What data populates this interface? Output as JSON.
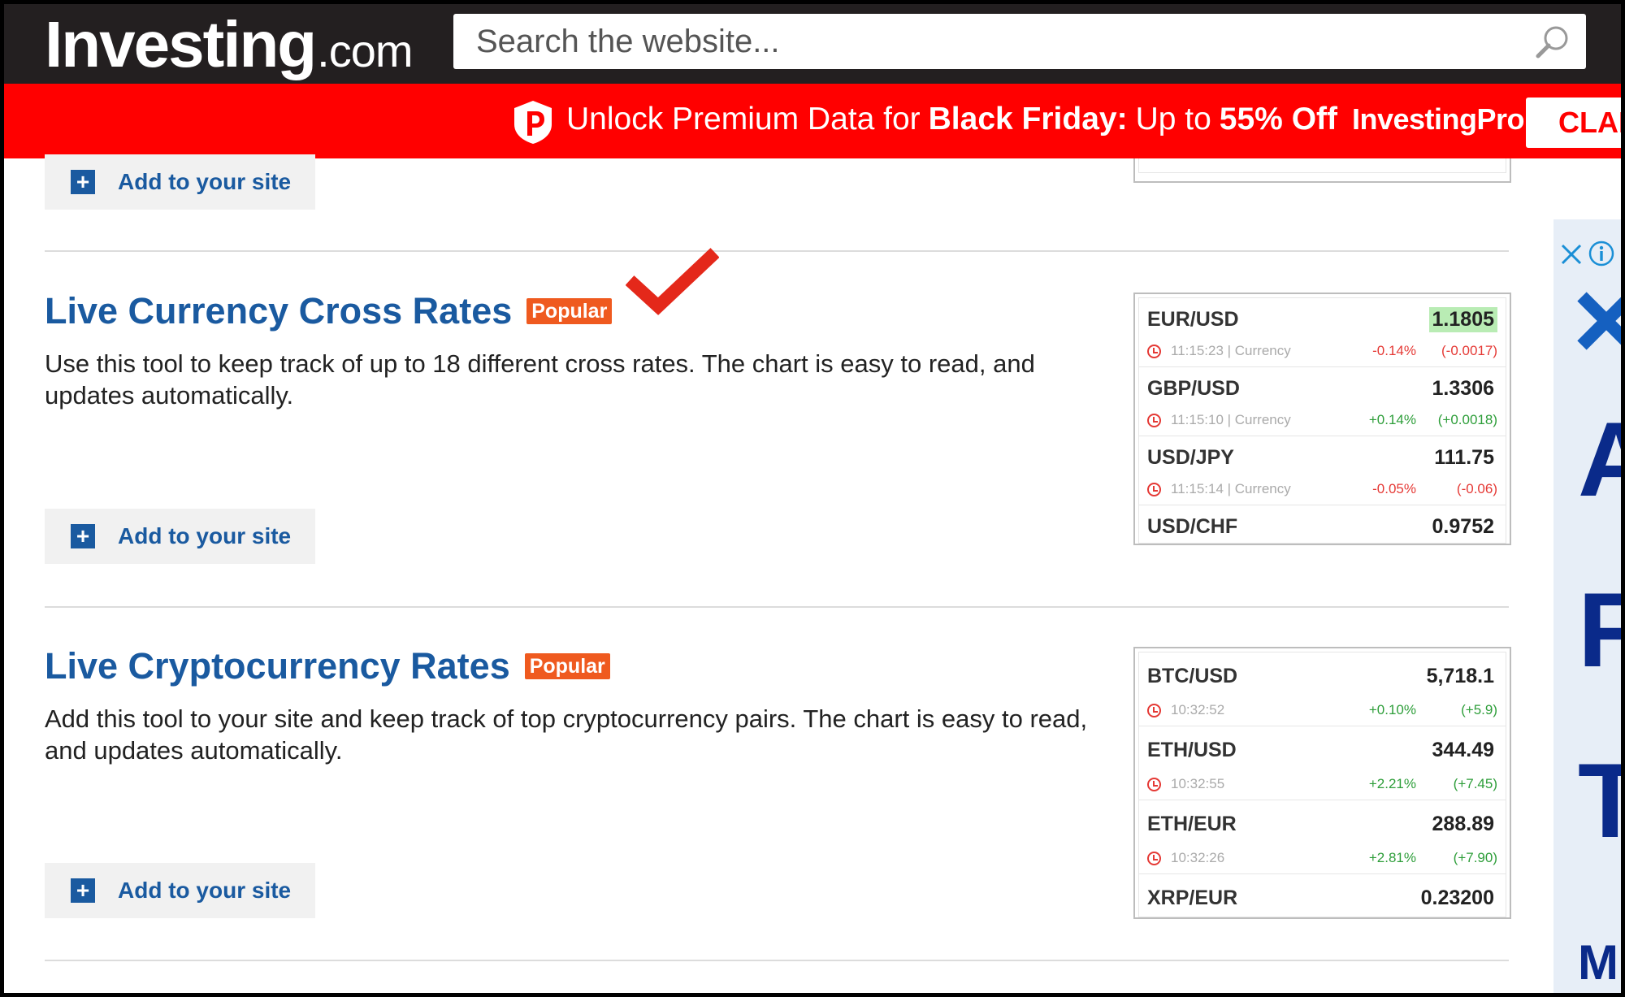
{
  "header": {
    "logo_brand": "Investing",
    "logo_tld": ".com",
    "search_placeholder": "Search the website..."
  },
  "promo": {
    "text_1": "Unlock Premium Data for",
    "text_bold": "Black Friday:",
    "text_2": "Up to",
    "discount": "55% Off",
    "brand": "InvestingPro",
    "cta": "CLAI"
  },
  "add_button_label": "Add to your site",
  "sections": [
    {
      "title": "Live Currency Cross Rates",
      "badge": "Popular",
      "description": "Use this tool to keep track of up to 18 different cross rates. The chart is easy to read, and updates automatically."
    },
    {
      "title": "Live Cryptocurrency Rates",
      "badge": "Popular",
      "description": "Add this tool to your site and keep track of top cryptocurrency pairs. The chart is easy to read, and updates automatically."
    }
  ],
  "currency_widget": [
    {
      "pair": "EUR/USD",
      "value": "1.1805",
      "time": "11:15:23 | Currency",
      "pct": "-0.14%",
      "chg": "(-0.0017)",
      "dir": "neg",
      "highlight": true
    },
    {
      "pair": "GBP/USD",
      "value": "1.3306",
      "time": "11:15:10 | Currency",
      "pct": "+0.14%",
      "chg": "(+0.0018)",
      "dir": "pos",
      "highlight": false
    },
    {
      "pair": "USD/JPY",
      "value": "111.75",
      "time": "11:15:14 | Currency",
      "pct": "-0.05%",
      "chg": "(-0.06)",
      "dir": "neg",
      "highlight": false
    },
    {
      "pair": "USD/CHF",
      "value": "0.9752"
    }
  ],
  "crypto_widget": [
    {
      "pair": "BTC/USD",
      "value": "5,718.1",
      "time": "10:32:52",
      "pct": "+0.10%",
      "chg": "(+5.9)",
      "dir": "pos"
    },
    {
      "pair": "ETH/USD",
      "value": "344.49",
      "time": "10:32:55",
      "pct": "+2.21%",
      "chg": "(+7.45)",
      "dir": "pos"
    },
    {
      "pair": "ETH/EUR",
      "value": "288.89",
      "time": "10:32:26",
      "pct": "+2.81%",
      "chg": "(+7.90)",
      "dir": "pos"
    },
    {
      "pair": "XRP/EUR",
      "value": "0.23200"
    }
  ],
  "ad": {
    "letters": [
      "A",
      "F",
      "T",
      "M"
    ]
  },
  "colors": {
    "brand_blue": "#1a5aa0",
    "promo_red": "#ff0000",
    "badge_orange": "#ef5a1f",
    "header_dark": "#231f20"
  }
}
